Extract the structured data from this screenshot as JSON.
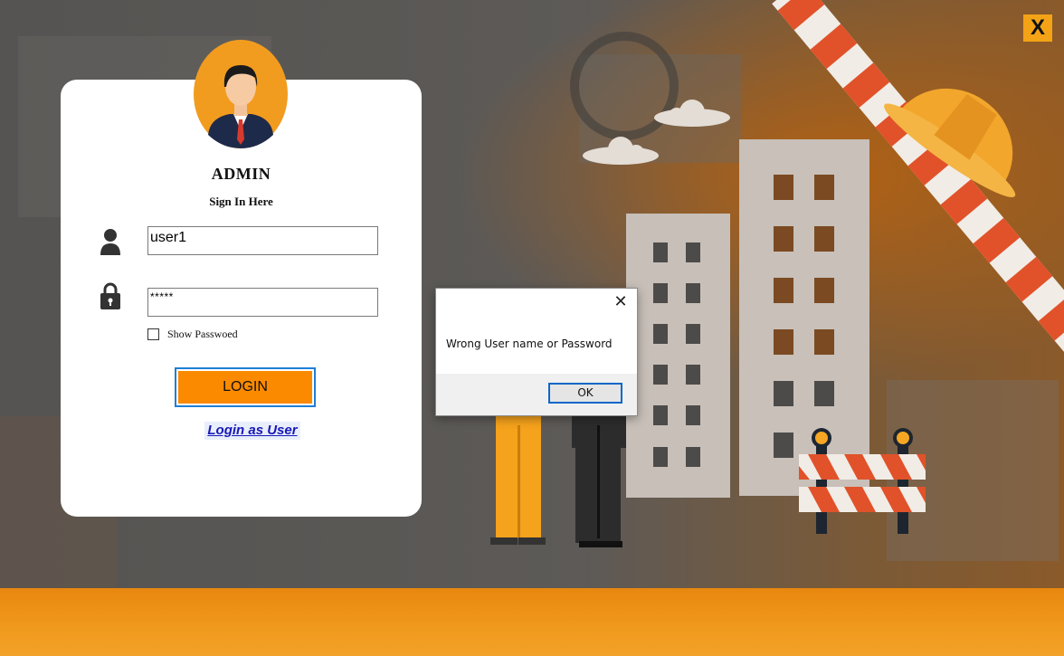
{
  "window": {
    "close_label": "X"
  },
  "login_panel": {
    "title": "ADMIN",
    "subtitle": "Sign In Here",
    "username_value": "user1",
    "password_value": "*****",
    "show_password_label": "Show Passwoed",
    "login_button_label": "LOGIN",
    "user_login_link": "Login as User"
  },
  "dialog": {
    "message": "Wrong User name or Password",
    "ok_label": "OK",
    "close_glyph": "✕"
  },
  "icons": [
    "user-icon",
    "lock-icon",
    "admin-avatar-icon",
    "close-icon"
  ],
  "colors": {
    "accent_orange": "#fb8a00",
    "brand_orange": "#f09a1c",
    "focus_blue": "#1f7fd6",
    "link_blue": "#1818b8"
  }
}
